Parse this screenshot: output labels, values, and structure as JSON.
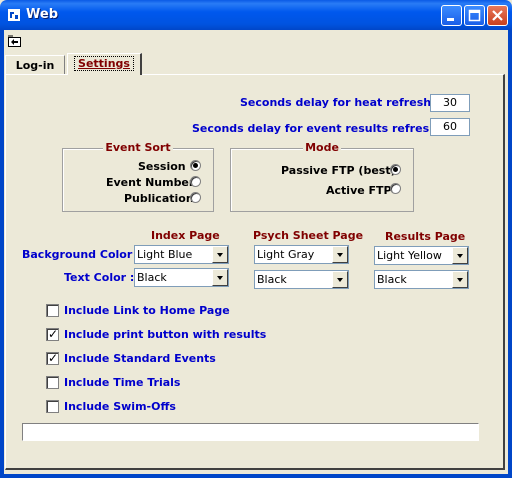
{
  "window": {
    "title": "Web"
  },
  "tabs": [
    {
      "label": "Log-in"
    },
    {
      "label": "Settings",
      "active": true
    }
  ],
  "settings": {
    "heat_refresh_label": "Seconds delay for heat refresh :",
    "heat_refresh_value": "30",
    "results_refresh_label": "Seconds delay for event results refresh :",
    "results_refresh_value": "60"
  },
  "event_sort": {
    "title": "Event Sort",
    "options": [
      {
        "label": "Session",
        "checked": true
      },
      {
        "label": "Event Number",
        "checked": false
      },
      {
        "label": "Publication",
        "checked": false
      }
    ]
  },
  "mode": {
    "title": "Mode",
    "options": [
      {
        "label": "Passive FTP (best)",
        "checked": true
      },
      {
        "label": "Active FTP",
        "checked": false
      }
    ]
  },
  "colors": {
    "headers": [
      "Index Page",
      "Psych Sheet Page",
      "Results Page"
    ],
    "background_label": "Background Color :",
    "text_label": "Text Color :",
    "index_bg": "Light Blue",
    "index_text": "Black",
    "psych_bg": "Light Gray",
    "psych_text": "Black",
    "results_bg": "Light Yellow",
    "results_text": "Black"
  },
  "options": [
    {
      "label": "Include Link to Home Page",
      "checked": false
    },
    {
      "label": "Include print button with results",
      "checked": true
    },
    {
      "label": "Include Standard Events",
      "checked": true
    },
    {
      "label": "Include Time Trials",
      "checked": false
    },
    {
      "label": "Include Swim-Offs",
      "checked": false
    }
  ],
  "status": ""
}
